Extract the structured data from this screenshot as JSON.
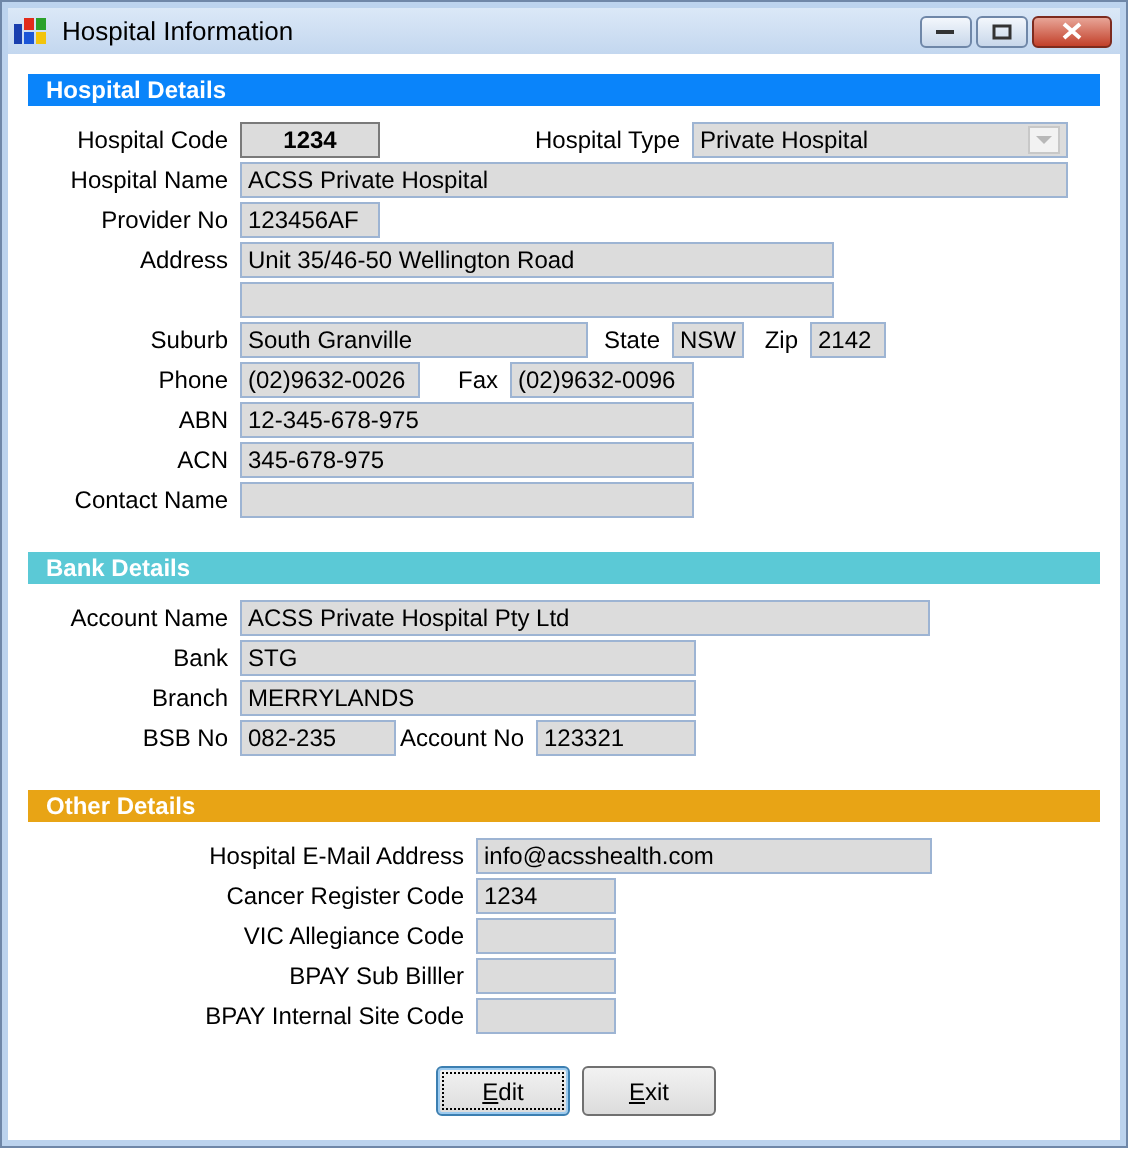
{
  "window": {
    "title": "Hospital Information"
  },
  "sections": [
    {
      "title": "Hospital Details",
      "color": "#0a84fa",
      "rows": [
        {
          "fields": [
            {
              "label": "Hospital Code",
              "value": "1234",
              "kind": "code"
            },
            {
              "label": "Hospital Type",
              "value": "Private Hospital",
              "kind": "dropdown"
            }
          ]
        },
        {
          "fields": [
            {
              "label": "Hospital Name",
              "value": "ACSS Private Hospital",
              "kind": "text"
            }
          ]
        },
        {
          "fields": [
            {
              "label": "Provider No",
              "value": "123456AF",
              "kind": "text"
            }
          ]
        },
        {
          "fields": [
            {
              "label": "Address",
              "value": "Unit 35/46-50 Wellington Road",
              "kind": "text"
            }
          ]
        },
        {
          "fields": [
            {
              "kind": "text"
            }
          ]
        },
        {
          "fields": [
            {
              "label": "Suburb",
              "value": "South Granville",
              "kind": "text"
            },
            {
              "label": "State",
              "value": "NSW",
              "kind": "text"
            },
            {
              "label": "Zip",
              "value": "2142",
              "kind": "text"
            }
          ]
        },
        {
          "fields": [
            {
              "label": "Phone",
              "value": "(02)9632-0026",
              "kind": "text"
            },
            {
              "label": "Fax",
              "value": "(02)9632-0096",
              "kind": "text"
            }
          ]
        },
        {
          "fields": [
            {
              "label": "ABN",
              "value": "12-345-678-975",
              "kind": "text"
            }
          ]
        },
        {
          "fields": [
            {
              "label": "ACN",
              "value": "345-678-975",
              "kind": "text"
            }
          ]
        },
        {
          "fields": [
            {
              "label": "Contact Name",
              "kind": "text"
            }
          ]
        }
      ]
    },
    {
      "title": "Bank Details",
      "color": "#5bc9d6",
      "rows": [
        {
          "fields": [
            {
              "label": "Account Name",
              "value": "ACSS Private Hospital Pty Ltd",
              "kind": "text"
            }
          ]
        },
        {
          "fields": [
            {
              "label": "Bank",
              "value": "STG",
              "kind": "text"
            }
          ]
        },
        {
          "fields": [
            {
              "label": "Branch",
              "value": "MERRYLANDS",
              "kind": "text"
            }
          ]
        },
        {
          "fields": [
            {
              "label": "BSB No",
              "value": "082-235",
              "kind": "text"
            },
            {
              "label": "Account No",
              "value": "123321",
              "kind": "text"
            }
          ]
        }
      ]
    },
    {
      "title": "Other Details",
      "color": "#e8a415",
      "rows": [
        {
          "fields": [
            {
              "label": "Hospital E-Mail Address",
              "value": "info@acsshealth.com",
              "kind": "text"
            }
          ]
        },
        {
          "fields": [
            {
              "label": "Cancer Register Code",
              "value": "1234",
              "kind": "text"
            }
          ]
        },
        {
          "fields": [
            {
              "label": "VIC Allegiance Code",
              "kind": "text"
            }
          ]
        },
        {
          "fields": [
            {
              "label": "BPAY Sub Billler",
              "kind": "text"
            }
          ]
        },
        {
          "fields": [
            {
              "label": "BPAY Internal Site Code",
              "kind": "text"
            }
          ]
        }
      ]
    }
  ],
  "buttons": [
    {
      "label": "Edit",
      "focused": true
    },
    {
      "label": "Exit",
      "focused": false
    }
  ]
}
